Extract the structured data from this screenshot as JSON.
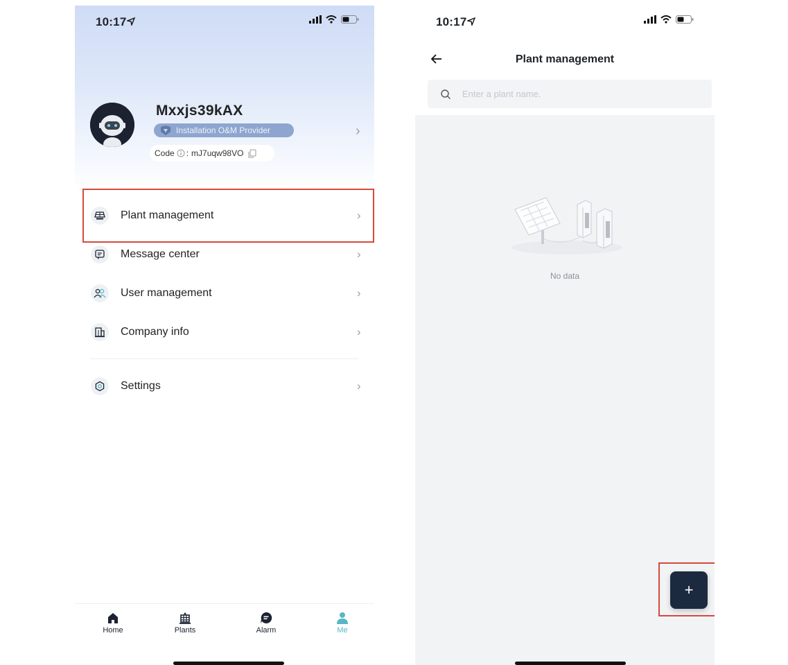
{
  "left_screen": {
    "status_bar": {
      "time": "10:17"
    },
    "profile": {
      "name": "Mxxjs39kAX",
      "role": "Installation O&M Provider",
      "code_label": "Code",
      "code_sep": ":",
      "code_value": "mJ7uqw98VO"
    },
    "menu": [
      {
        "label": "Plant management",
        "icon": "solar-panel-icon"
      },
      {
        "label": "Message center",
        "icon": "message-icon"
      },
      {
        "label": "User management",
        "icon": "users-icon"
      },
      {
        "label": "Company info",
        "icon": "building-icon"
      },
      {
        "label": "Settings",
        "icon": "gear-icon"
      }
    ],
    "tabs": [
      {
        "label": "Home",
        "icon": "home-icon"
      },
      {
        "label": "Plants",
        "icon": "plants-icon"
      },
      {
        "label": "Alarm",
        "icon": "alarm-icon"
      },
      {
        "label": "Me",
        "icon": "me-icon",
        "active": true
      }
    ]
  },
  "right_screen": {
    "status_bar": {
      "time": "10:17"
    },
    "title": "Plant management",
    "search": {
      "placeholder": "Enter a plant name.",
      "value": ""
    },
    "empty_text": "No data",
    "fab_label": "+"
  },
  "colors": {
    "accent": "#58b7c3",
    "dark_button": "#1c2a40",
    "highlight": "#d44a3c",
    "badge": "#8ea6cf"
  }
}
